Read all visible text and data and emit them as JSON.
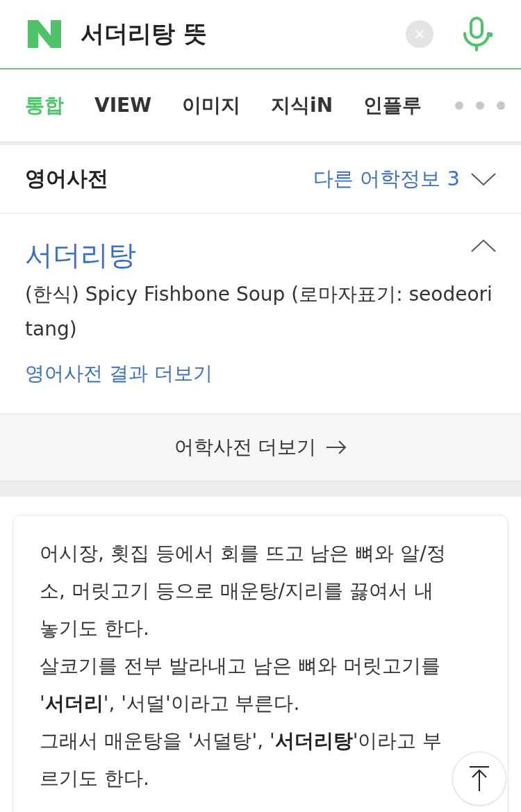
{
  "search": {
    "query": "서더리탕 뜻"
  },
  "tabs": [
    {
      "label": "통합",
      "selected": true
    },
    {
      "label": "VIEW",
      "selected": false
    },
    {
      "label": "이미지",
      "selected": false
    },
    {
      "label": "지식iN",
      "selected": false
    },
    {
      "label": "인플루",
      "selected": false
    }
  ],
  "dictionary": {
    "title": "영어사전",
    "other_info": "다른 어학정보 3",
    "entry": {
      "headword": "서더리탕",
      "expanded": true,
      "definition": "(한식) Spicy Fishbone Soup (로마자표기: seodeori tang)",
      "more_link": "영어사전 결과 더보기"
    },
    "more_button": "어학사전 더보기"
  },
  "article": {
    "paragraphs": [
      "어시장, 횟집 등에서 회를 뜨고 남은 뼈와 알/정소, 머릿고기 등으로 매운탕/지리를 끓여서 내놓기도 한다.",
      "살코기를 전부 발라내고 남은 뼈와 머릿고기를 '**서더리**', '서덜'이라고 부른다.",
      "그래서 매운탕을 '서덜탕', '**서더리탕**'이라고 부르기도 한다."
    ]
  }
}
